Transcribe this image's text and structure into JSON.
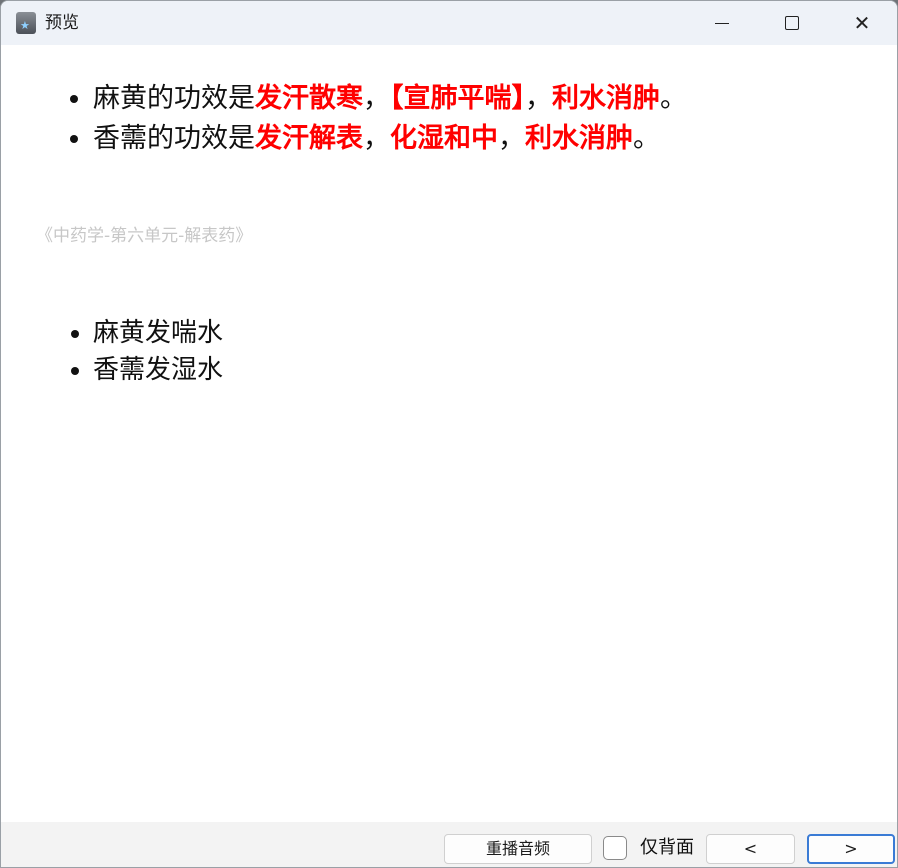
{
  "window": {
    "title": "预览",
    "icon": "app-star-icon",
    "controls": {
      "minimize": "minimize-icon",
      "maximize": "maximize-icon",
      "close": "close-icon",
      "close_glyph": "✕"
    }
  },
  "card": {
    "front": [
      {
        "prefix": "麻黄的功效是",
        "effect1": "发汗散寒",
        "sep1": "，",
        "effect2": "【宣肺平喘】",
        "sep2": "，",
        "effect3": "利水消肿",
        "end": "。"
      },
      {
        "prefix": "香薷的功效是",
        "effect1": "发汗解表",
        "sep1": "，",
        "effect2": "化湿和中",
        "sep2": "，",
        "effect3": "利水消肿",
        "end": "。"
      }
    ],
    "source": "《中药学-第六单元-解表药》",
    "back": [
      "麻黄发喘水",
      "香薷发湿水"
    ]
  },
  "bottom": {
    "replay_label": "重播音频",
    "back_only_label": "仅背面",
    "back_only_checked": false,
    "prev_label": "<",
    "next_label": ">"
  },
  "colors": {
    "highlight": "#ff0000",
    "source_text": "#c7c7c7",
    "focus_border": "#3a7bd5"
  }
}
